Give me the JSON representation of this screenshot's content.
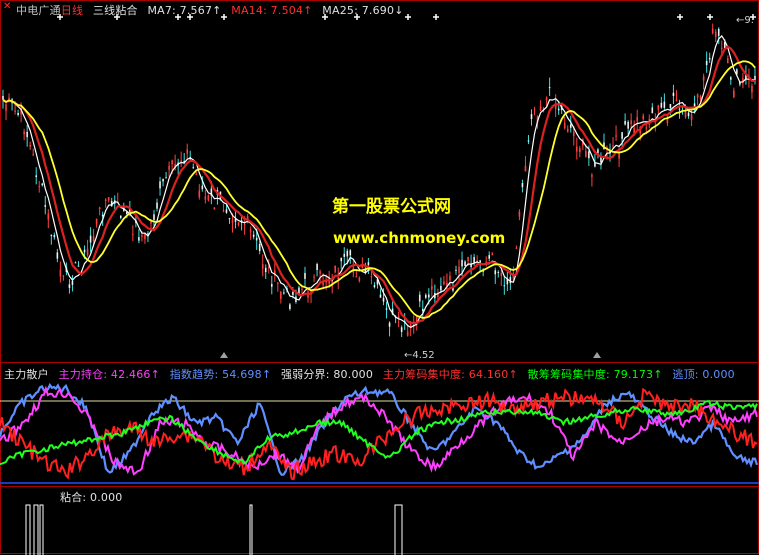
{
  "price_panel": {
    "stock_name": "中电广通",
    "period": "日线",
    "indicator": "三线粘合",
    "ma7_label": "MA7: 7.567↑",
    "ma14_label": "MA14: 7.504↑",
    "ma25_label": "MA25: 7.690↓",
    "high_marker": "9.",
    "low_marker": "4.52",
    "watermark_title": "第一股票公式网",
    "watermark_url": "www.chnmoney.com"
  },
  "indicator_panel": {
    "name": "主力散户",
    "main_holding": "主力持仓: 42.466↑",
    "index_trend": "指数趋势: 54.698↑",
    "strong_weak": "强弱分界: 80.000",
    "main_chip": "主力筹码集中度: 64.160↑",
    "retail_chip": "散筹筹码集中度: 79.173↑",
    "escape": "逃顶: 0.000"
  },
  "stick_panel": {
    "label": "粘合: 0.000"
  },
  "colors": {
    "red": "#ff3030",
    "yellow": "#ffff00",
    "green": "#00ff00",
    "magenta": "#ff40ff",
    "blue": "#6090ff",
    "white": "#e0e0e0"
  }
}
